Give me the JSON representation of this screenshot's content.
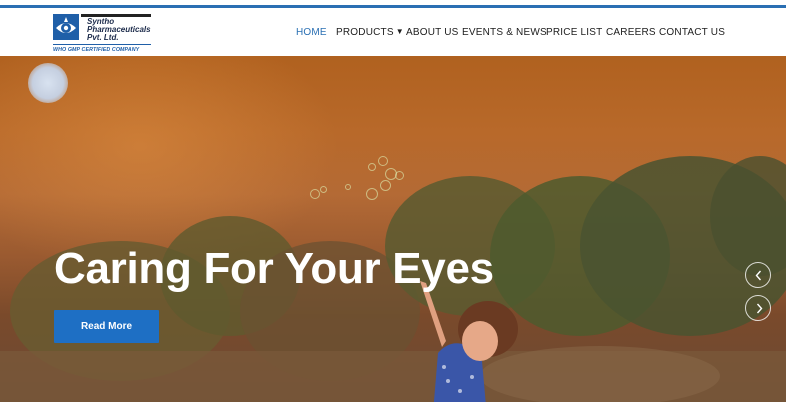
{
  "brand": {
    "name": "Syntho\nPharmaceuticals\nPvt. Ltd.",
    "tagline": "WHO GMP CERTIFIED COMPANY"
  },
  "nav": {
    "items": [
      {
        "label": "HOME",
        "active": true
      },
      {
        "label": "PRODUCTS",
        "has_dropdown": true
      },
      {
        "label": "ABOUT US"
      },
      {
        "label": "EVENTS & NEWS"
      },
      {
        "label": "PRICE LIST"
      },
      {
        "label": "CAREERS"
      },
      {
        "label": "CONTACT US"
      }
    ]
  },
  "hero": {
    "title": "Caring For Your Eyes",
    "cta_label": "Read More",
    "prev_icon": "chevron-left-icon",
    "next_icon": "chevron-right-icon"
  },
  "colors": {
    "accent": "#2a6fb3",
    "button": "#1e6fc4",
    "hero_bg": "#b0611f"
  }
}
